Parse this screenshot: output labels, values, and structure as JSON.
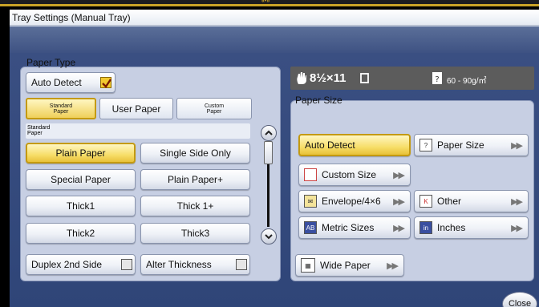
{
  "window": {
    "title": "Tray Settings (Manual Tray)"
  },
  "top_indicator": "«•»",
  "paper_type": {
    "label": "Paper Type",
    "auto_detect": {
      "label": "Auto Detect",
      "checked": true
    },
    "tabs": [
      {
        "label_line1": "Standard",
        "label_line2": "Paper",
        "selected": true
      },
      {
        "label": "User Paper",
        "selected": false
      },
      {
        "label_line1": "Custom",
        "label_line2": "Paper",
        "selected": false
      }
    ],
    "subheading_line1": "Standard",
    "subheading_line2": "Paper",
    "buttons": [
      {
        "label": "Plain Paper",
        "selected": true
      },
      {
        "label": "Single Side Only",
        "selected": false
      },
      {
        "label": "Special Paper",
        "selected": false
      },
      {
        "label": "Plain Paper+",
        "selected": false
      },
      {
        "label": "Thick1",
        "selected": false
      },
      {
        "label": "Thick 1+",
        "selected": false
      },
      {
        "label": "Thick2",
        "selected": false
      },
      {
        "label": "Thick3",
        "selected": false
      }
    ],
    "duplex": {
      "label": "Duplex 2nd Side",
      "checked": false
    },
    "alter_thickness": {
      "label": "Alter Thickness",
      "checked": false
    }
  },
  "status": {
    "paper_size": "8½×11",
    "weight": "60 - 90g/㎡"
  },
  "paper_size": {
    "label": "Paper Size",
    "buttons": {
      "auto_detect": {
        "label": "Auto Detect",
        "selected": true
      },
      "paper_size": {
        "label": "Paper Size",
        "icon": "paper-size-icon"
      },
      "custom_size": {
        "label": "Custom Size",
        "icon": "custom-size-icon"
      },
      "envelope": {
        "label": "Envelope/4×6",
        "icon": "envelope-icon"
      },
      "other": {
        "label": "Other",
        "icon": "other-size-icon"
      },
      "metric": {
        "label": "Metric Sizes",
        "icon": "metric-icon"
      },
      "inches": {
        "label": "Inches",
        "icon": "inches-icon"
      },
      "wide": {
        "label": "Wide Paper",
        "icon": "wide-paper-icon"
      }
    }
  },
  "close_label": "Close",
  "colors": {
    "accent_yellow": "#f2c92f",
    "window_blue": "#2f4578",
    "panel": "#c7cfe3"
  }
}
